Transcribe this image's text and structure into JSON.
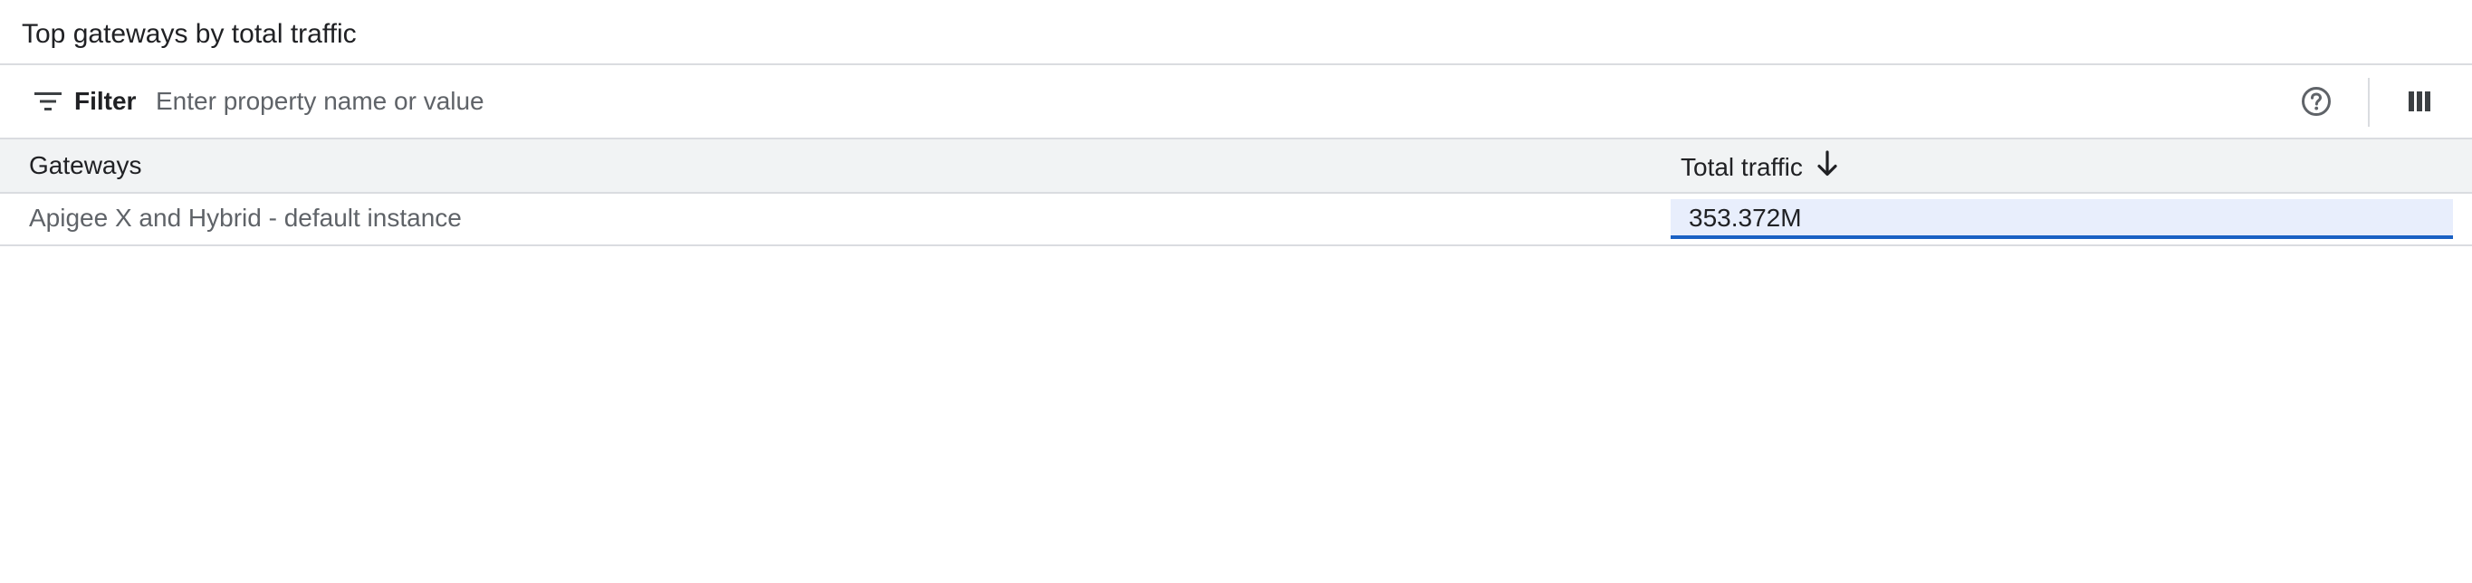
{
  "panel": {
    "title": "Top gateways by total traffic"
  },
  "toolbar": {
    "filter_label": "Filter",
    "filter_placeholder": "Enter property name or value",
    "filter_value": "",
    "icons": {
      "filter": "filter-icon",
      "help": "help-circle-icon",
      "columns": "column-display-icon"
    }
  },
  "table": {
    "columns": [
      {
        "label": "Gateways",
        "sorted": false
      },
      {
        "label": "Total traffic",
        "sorted": true,
        "sort_direction": "descending"
      }
    ],
    "rows": [
      {
        "gateway": "Apigee X and Hybrid - default instance",
        "total_traffic": "353.372M",
        "highlighted": true
      }
    ]
  },
  "colors": {
    "header_bg": "#f1f3f4",
    "divider": "#dadce0",
    "highlight_bg": "#e8eefc",
    "highlight_border": "#1a61c4"
  }
}
